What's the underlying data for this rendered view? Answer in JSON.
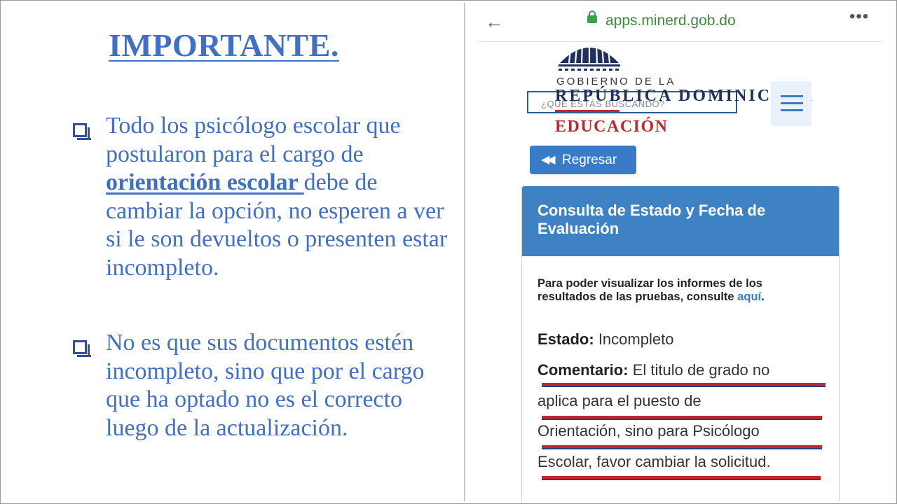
{
  "slide": {
    "title": "IMPORTANTE.",
    "bullet1": {
      "line1": "Todo los psicólogo escolar que postularon para el cargo de",
      "emphasis": "orientación escolar ",
      "line2": "debe de cambiar la opción, no esperen a ver si le son devueltos o presenten estar incompleto."
    },
    "bullet2": {
      "text": "No es que sus documentos estén incompleto, sino que por el cargo que ha optado no es el correcto luego de la actualización."
    }
  },
  "browser": {
    "url": "apps.minerd.gob.do",
    "back_icon": "arrow-left-icon",
    "menu_icon": "more-dots-icon"
  },
  "site": {
    "gob_label": "GOBIERNO DE LA",
    "republica_label": "REPÚBLICA DOMINICANA",
    "educacion_label": "EDUCACIÓN",
    "search_placeholder": "¿QUÉ ESTÁS BUSCANDO?",
    "back_button_label": "Regresar",
    "brand_blue": "#3a7bc8",
    "brand_red": "#c4282f"
  },
  "card": {
    "title": "Consulta de Estado y Fecha de Evaluación",
    "info_text": "Para poder visualizar los informes de los resultados de las pruebas, consulte",
    "info_link": "aquí",
    "estado_label": "Estado:",
    "estado_value": "Incompleto",
    "comentario_label": "Comentario:",
    "comentario_line1": "El titulo de grado no",
    "comentario_line2": "aplica para el puesto de",
    "comentario_line3": "Orientación, sino para Psicólogo",
    "comentario_line4": "Escolar, favor cambiar la solicitud."
  }
}
